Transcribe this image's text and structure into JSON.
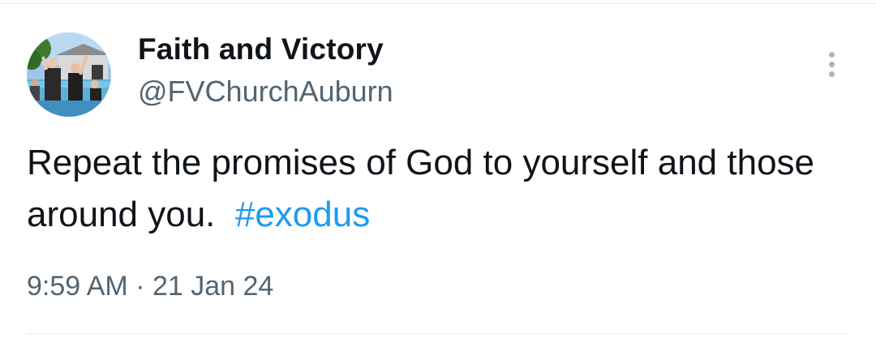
{
  "author": {
    "display_name": "Faith and Victory",
    "handle": "@FVChurchAuburn",
    "avatar_icon": "profile-photo"
  },
  "tweet": {
    "text": "Repeat the promises of God to yourself and those around you.",
    "hashtag": "#exodus"
  },
  "meta": {
    "time": "9:59 AM",
    "separator": "·",
    "date": "21 Jan 24"
  },
  "actions": {
    "more_icon": "more-vertical-icon"
  },
  "colors": {
    "text": "#0f1419",
    "secondary": "#536471",
    "link": "#1d9bf0",
    "divider": "#e6e9ec"
  }
}
